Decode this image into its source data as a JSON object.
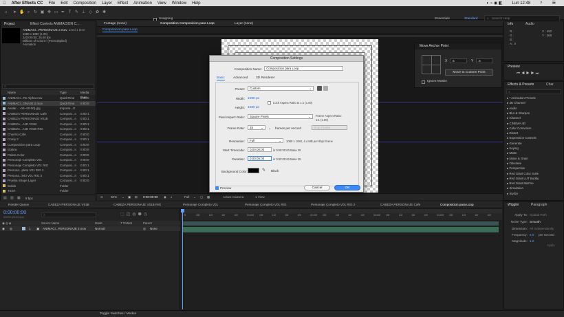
{
  "menubar": {
    "apple": "",
    "app": "After Effects CC",
    "items": [
      "File",
      "Edit",
      "Composition",
      "Layer",
      "Effect",
      "Animation",
      "View",
      "Window",
      "Help"
    ],
    "clock": "Lun 12:48"
  },
  "toolbar": {
    "snapping": "Snapping",
    "workspaces": [
      "Essentials",
      "Standard"
    ],
    "search_placeholder": "Search Help"
  },
  "project": {
    "tab": "Project",
    "effects_tab": "Effect Controls ANIMACION C...",
    "selected_name": "ANIMACI...PERSONAJE 2.mov",
    "selected_used": ", used 1 time",
    "selected_info": [
      "1080 x 1080 (1.00)",
      "Δ 00:05:00, 25.00 fps",
      "Millions of Colors+ (Premultiplied)",
      "Animation"
    ],
    "search_placeholder": "",
    "col_name": "Name",
    "col_type": "Type",
    "col_media": "Media Dura",
    "items": [
      {
        "name": "ANIMACI...FE Alpha.mov",
        "type": "QuickTime",
        "dur": "0:00:0",
        "color": "#9ebcd6"
      },
      {
        "name": "ANIMACI...ONAJE 2.mov",
        "type": "QuickTime",
        "dur": "0:00:0",
        "color": "#9ebcd6"
      },
      {
        "name": "Avatar ...-00--00-00).jpg",
        "type": "Importe...G",
        "dur": "",
        "color": "#9ebcd6"
      },
      {
        "name": "CABEZA PERSONAJE Cafe",
        "type": "Composi...n",
        "dur": "0:00:1",
        "color": "#b6a4c6"
      },
      {
        "name": "CABEZA PERSONAJE V01B",
        "type": "Composi...n",
        "dur": "0:00:1",
        "color": "#b6a4c6"
      },
      {
        "name": "CABEZA...AJE V01B",
        "type": "Composi...n",
        "dur": "0:00:1",
        "color": "#b6a4c6"
      },
      {
        "name": "CABEZA...AJE V01B RIG",
        "type": "Composi...n",
        "dur": "0:00:1",
        "color": "#b6a4c6"
      },
      {
        "name": "Chorrito Cafe",
        "type": "Composi...n",
        "dur": "0:00:0",
        "color": "#b6a4c6"
      },
      {
        "name": "Comp 2",
        "type": "Composi...n",
        "dur": "0:00:1",
        "color": "#b6a4c6"
      },
      {
        "name": "Composicion para Loop",
        "type": "Composi...n",
        "dur": "0:00:0",
        "color": "#b6a4c6"
      },
      {
        "name": "Gotina",
        "type": "Composi...n",
        "dur": "0:00:0",
        "color": "#b6a4c6"
      },
      {
        "name": "Paleta Color",
        "type": "Composi...n",
        "dur": "0:00:0",
        "color": "#b6a4c6"
      },
      {
        "name": "Personaje Completo V01",
        "type": "Composi...n",
        "dur": "0:00:0",
        "color": "#b6a4c6"
      },
      {
        "name": "Personaje Completo V01 RIG",
        "type": "Composi...n",
        "dur": "0:00:1",
        "color": "#b6a4c6"
      },
      {
        "name": "Persona...pleto V01 RIG 2",
        "type": "Composi...n",
        "dur": "0:00:1",
        "color": "#b6a4c6"
      },
      {
        "name": "Persona...leto V01 RIG 3",
        "type": "Composi...n",
        "dur": "0:00:1",
        "color": "#b6a4c6"
      },
      {
        "name": "Prueba Shape Layer",
        "type": "Composi...n",
        "dur": "0:00:0",
        "color": "#b6a4c6"
      },
      {
        "name": "Solids",
        "type": "Folder",
        "dur": "",
        "color": "#d6c36a"
      },
      {
        "name": "TEST",
        "type": "Folder",
        "dur": "",
        "color": "#d6c36a"
      }
    ],
    "footer": "8 bpc"
  },
  "viewer": {
    "footage_tab": "Footage (none)",
    "comp_tab": "Composition Composicion para Loop",
    "layer_tab": "Layer (none)",
    "breadcrumb": "Composicion para Loop",
    "zoom": "50%",
    "timecode": "0:00:00:00",
    "res": "Full",
    "camera": "Active Camera",
    "views": "1 View"
  },
  "dialog": {
    "title": "Composition Settings",
    "comp_name_label": "Composition Name:",
    "comp_name": "Composicion para Loop",
    "tabs": [
      "Basic",
      "Advanced",
      "3D Renderer"
    ],
    "preset_label": "Preset:",
    "preset": "Custom",
    "width_label": "Width:",
    "width": "1080 px",
    "height_label": "Height:",
    "height": "1080 px",
    "lock_label": "Lock Aspect Ratio to 1:1 (1.00)",
    "par_label": "Pixel Aspect Ratio:",
    "par": "Square Pixels",
    "frame_aspect_label": "Frame Aspect Ratio:",
    "frame_aspect": "1:1 (1.00)",
    "fps_label": "Frame Rate:",
    "fps": "25",
    "fps_unit": "frames per second",
    "drop_frame": "Drop Frame",
    "res_label": "Resolution:",
    "res": "Full",
    "res_info": "1080 x 1080, 4.4 MB per 8bpc frame",
    "start_label": "Start Timecode:",
    "start": "0:00:00:00",
    "start_info": "is 0:00:00:00  Base 25",
    "dur_label": "Duration:",
    "dur": "0:00:05:00",
    "dur_info": "is 0:00:05:00  Base 25",
    "bg_label": "Background Color:",
    "bg_name": "Black",
    "preview": "Preview",
    "cancel": "Cancel",
    "ok": "OK"
  },
  "anchor": {
    "title": "Move Anchor Point",
    "x_label": "X",
    "x": ".5",
    "y_label": "Y",
    "y": ".5",
    "button": "Move to Custom Point",
    "ignore": "Ignore Masks"
  },
  "info": {
    "tab": "Info",
    "audio_tab": "Audio",
    "r": "R :",
    "g": "G :",
    "b": "B :",
    "a": "A : 0",
    "x": "X : 492",
    "y": "Y : 368"
  },
  "preview_panel": {
    "tab": "Preview"
  },
  "effects": {
    "tab": "Effects & Presets",
    "char_tab": "Char",
    "items": [
      "* Animation Presets",
      "3D Channel",
      "Audio",
      "Blur & Sharpen",
      "Channel",
      "CINEMA 4D",
      "Color Correction",
      "Distort",
      "Expression Controls",
      "Generate",
      "Keying",
      "Matte",
      "Noise & Grain",
      "Obsolete",
      "Perspective",
      "Red Giant Color Suite",
      "Red Giant LUT Buddy",
      "Red Giant MisFire",
      "Simulation",
      "Stylize"
    ]
  },
  "wiggler": {
    "tab": "Wiggler",
    "para_tab": "Paragraph",
    "apply_label": "Apply To:",
    "apply": "Spatial Path",
    "noise_label": "Noise Type:",
    "noise": "Smooth",
    "dim_label": "Dimension:",
    "dim": "All Independently",
    "freq_label": "Frequency:",
    "freq": "5.0",
    "freq_unit": "per second",
    "mag_label": "Magnitude:",
    "mag": "1.0",
    "apply_btn": "Apply"
  },
  "timeline": {
    "render_queue": "Render Queue",
    "tabs": [
      "CABEZA PERSONAJE V01B",
      "CABEZA PERSONAJE V01B RIG",
      "Personaje Completo V01",
      "Personaje Completo V01 RIG",
      "Personaje Completo V01 RIG 2",
      "CABEZA PERSONAJE Cafe",
      "Composicion para Loop"
    ],
    "timecode": "0:00:00:00",
    "timecode_sub": "00000 (25.00 fps)",
    "col_source": "Source Name",
    "col_mode": "Mode",
    "col_trkmat": "T TrkMat",
    "col_parent": "Parent",
    "layer_num": "1",
    "layer_name": "ANIMACI...PERSONAJE 2.mov",
    "layer_mode": "Normal",
    "layer_parent": "None",
    "ticks": [
      "0f",
      "05f",
      "10f",
      "15f",
      "20f",
      "01:00f",
      "05f",
      "10f",
      "15f",
      "20f",
      "02:00f",
      "05f",
      "10f",
      "15f",
      "20f",
      "03:00f",
      "05f",
      "10f",
      "15f",
      "20f",
      "04:00f",
      "05f",
      "10f",
      "15f",
      "20f"
    ],
    "footer": "Toggle Switches / Modes"
  }
}
